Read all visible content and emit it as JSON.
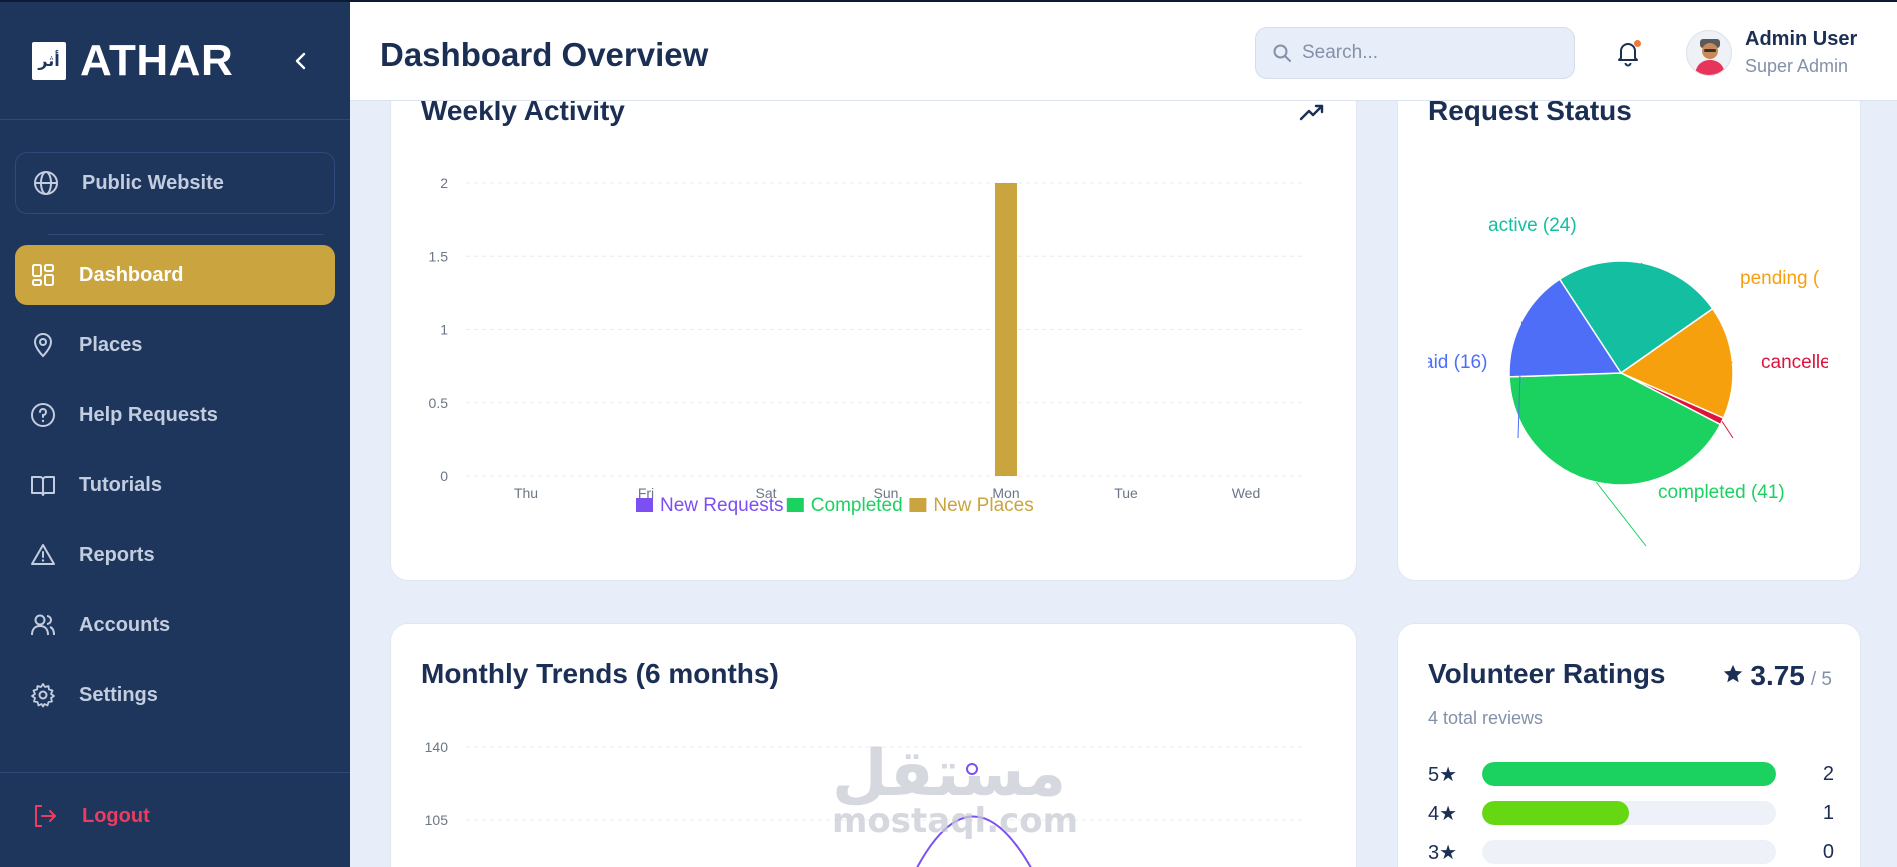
{
  "brand": {
    "name": "ATHAR",
    "logo_text": "أثر"
  },
  "sidebar": {
    "public_website": "Public Website",
    "items": [
      {
        "label": "Dashboard",
        "icon": "grid-icon",
        "active": true
      },
      {
        "label": "Places",
        "icon": "map-pin-icon",
        "active": false
      },
      {
        "label": "Help Requests",
        "icon": "help-circle-icon",
        "active": false
      },
      {
        "label": "Tutorials",
        "icon": "book-icon",
        "active": false
      },
      {
        "label": "Reports",
        "icon": "alert-triangle-icon",
        "active": false
      },
      {
        "label": "Accounts",
        "icon": "users-icon",
        "active": false
      },
      {
        "label": "Settings",
        "icon": "gear-icon",
        "active": false
      }
    ],
    "logout": "Logout"
  },
  "header": {
    "title": "Dashboard Overview",
    "search_placeholder": "Search...",
    "user_name": "Admin User",
    "user_role": "Super Admin"
  },
  "colors": {
    "sidebar": "#1e355c",
    "accent_gold": "#c9a43f",
    "new_requests": "#7b4ff2",
    "completed": "#1bd160",
    "new_places": "#c9a43f",
    "logout": "#ef3b5d"
  },
  "cards": {
    "weekly": {
      "title": "Weekly Activity"
    },
    "status": {
      "title": "Request Status"
    },
    "monthly": {
      "title": "Monthly Trends (6 months)"
    },
    "ratings": {
      "title": "Volunteer Ratings",
      "average": "3.75",
      "out_of": "/ 5",
      "total": "4 total reviews",
      "rows": [
        {
          "label": "5★",
          "count": "2",
          "fraction": 1.0,
          "color": "#1bd160"
        },
        {
          "label": "4★",
          "count": "1",
          "fraction": 0.5,
          "color": "#66d813"
        },
        {
          "label": "3★",
          "count": "0",
          "fraction": 0,
          "color": "#eef2f8"
        }
      ]
    }
  },
  "chart_data": [
    {
      "type": "bar",
      "categories": [
        "Thu",
        "Fri",
        "Sat",
        "Sun",
        "Mon",
        "Tue",
        "Wed"
      ],
      "series": [
        {
          "name": "New Requests",
          "color": "#7b4ff2",
          "values": [
            0,
            0,
            0,
            0,
            0,
            0,
            0
          ]
        },
        {
          "name": "Completed",
          "color": "#1bd160",
          "values": [
            0,
            0,
            0,
            0,
            0,
            0,
            0
          ]
        },
        {
          "name": "New Places",
          "color": "#c9a43f",
          "values": [
            0,
            0,
            0,
            0,
            2,
            0,
            0
          ]
        }
      ],
      "yticks": [
        "0",
        "0.5",
        "1",
        "1.5",
        "2"
      ],
      "ylim": [
        0,
        2
      ],
      "grid": true,
      "legend": "bottom"
    },
    {
      "type": "pie",
      "slices": [
        {
          "label": "active (24)",
          "value": 24,
          "color": "#13bfa0"
        },
        {
          "label": "pending (",
          "value": 16,
          "color": "#f7a00e"
        },
        {
          "label": "cancelle",
          "value": 1,
          "color": "#dc143c"
        },
        {
          "label": "completed (41)",
          "value": 41,
          "color": "#1bd160"
        },
        {
          "label": "aid (16)",
          "value": 16,
          "color": "#4e6ef7"
        }
      ]
    },
    {
      "type": "line",
      "yticks": [
        "140",
        "105"
      ],
      "series": [
        {
          "color": "#7b4ff2",
          "peak": 133
        }
      ]
    }
  ],
  "watermark": {
    "arabic": "مستقل",
    "latin": "mostaql.com"
  }
}
